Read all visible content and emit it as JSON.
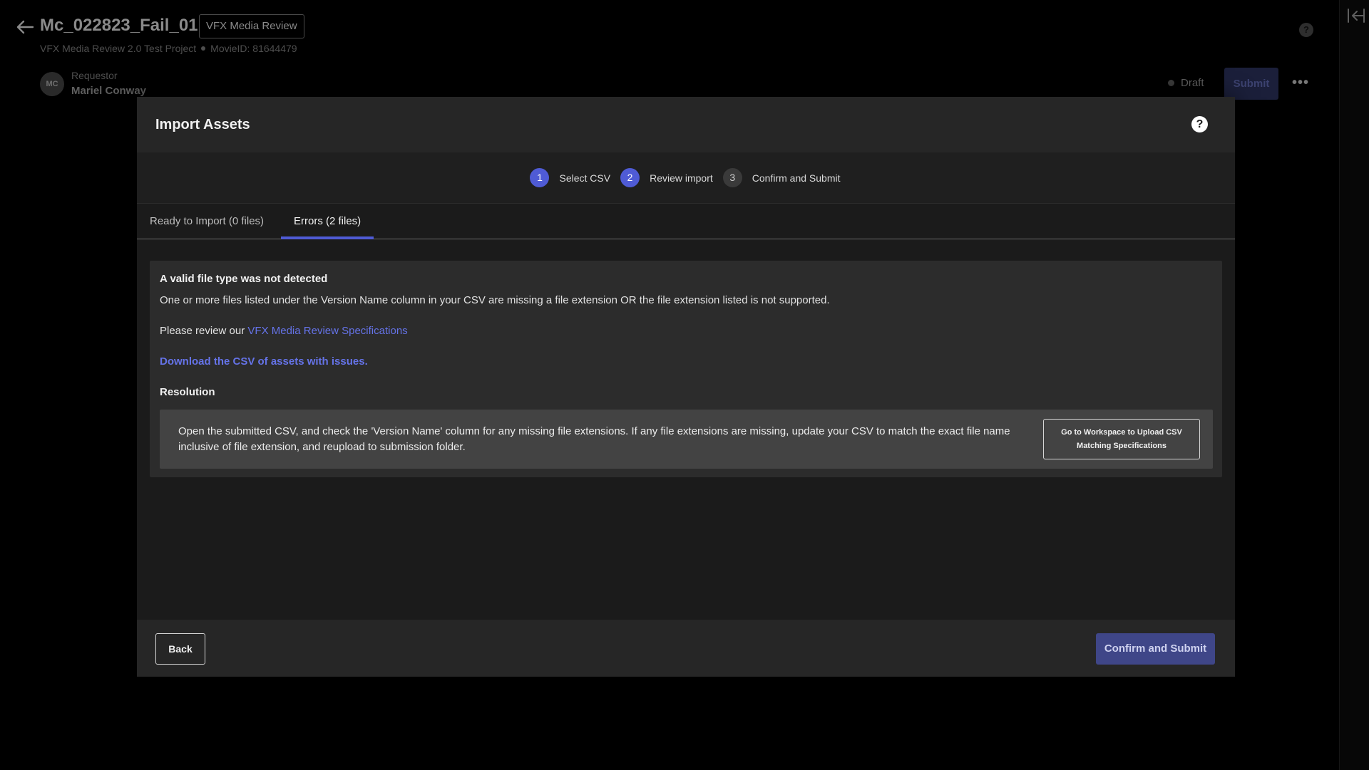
{
  "page": {
    "title": "Mc_022823_Fail_01",
    "tag": "VFX Media Review",
    "project": "VFX Media Review 2.0 Test Project",
    "movie_id": "MovieID: 81644479",
    "requestor_label": "Requestor",
    "requestor_name": "Mariel Conway",
    "avatar_initials": "MC",
    "status": "Draft",
    "submit_label": "Submit",
    "help_glyph": "?",
    "more_glyph": "•••"
  },
  "modal": {
    "title": "Import Assets",
    "help_glyph": "?",
    "steps": [
      {
        "num": "1",
        "label": "Select CSV",
        "state": "active"
      },
      {
        "num": "2",
        "label": "Review import",
        "state": "active"
      },
      {
        "num": "3",
        "label": "Confirm and Submit",
        "state": "inactive"
      }
    ],
    "tabs": [
      {
        "label": "Ready to Import (0 files)",
        "selected": false
      },
      {
        "label": "Errors (2 files)",
        "selected": true
      }
    ],
    "error": {
      "title": "A valid file type was not detected",
      "description": "One or more files listed under the Version Name column in your CSV are missing a file extension OR the file extension listed is not supported.",
      "review_prefix": "Please review our ",
      "review_link": "VFX Media Review Specifications",
      "download_link": "Download the CSV of assets with issues.",
      "resolution_title": "Resolution",
      "resolution_text": "Open the submitted CSV, and check the 'Version Name' column for any missing file extensions. If any file extensions are missing, update your CSV to match the exact file name inclusive of file extension, and reupload to submission folder.",
      "resolution_button": "Go to Workspace to Upload CSV Matching Specifications"
    },
    "footer": {
      "back_label": "Back",
      "confirm_label": "Confirm and Submit"
    }
  },
  "colors": {
    "accent": "#4f5bd5",
    "link": "#6573e8",
    "confirm_bg": "#3f4688"
  },
  "icons": {
    "back": "arrow-left-icon",
    "collapse": "collapse-panel-icon",
    "help": "help-icon",
    "more": "more-horizontal-icon"
  }
}
